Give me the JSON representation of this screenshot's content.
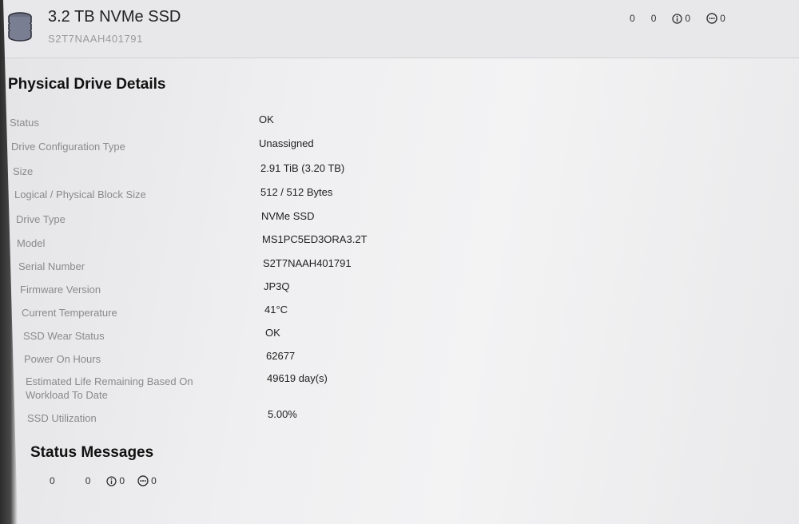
{
  "header": {
    "title": "3.2 TB NVMe SSD",
    "serial": "S2T7NAAH401791",
    "counters": [
      "0",
      "0",
      "0",
      "0"
    ]
  },
  "details": {
    "title": "Physical Drive Details",
    "rows": [
      {
        "label": "Status",
        "value": "OK"
      },
      {
        "label": "Drive Configuration Type",
        "value": "Unassigned"
      },
      {
        "label": "Size",
        "value": "2.91 TiB (3.20 TB)"
      },
      {
        "label": "Logical / Physical Block Size",
        "value": "512 / 512 Bytes"
      },
      {
        "label": "Drive Type",
        "value": "NVMe SSD"
      },
      {
        "label": "Model",
        "value": "MS1PC5ED3ORA3.2T"
      },
      {
        "label": "Serial Number",
        "value": "S2T7NAAH401791"
      },
      {
        "label": "Firmware Version",
        "value": "JP3Q"
      },
      {
        "label": "Current Temperature",
        "value": "41°C"
      },
      {
        "label": "SSD Wear Status",
        "value": "OK"
      },
      {
        "label": "Power On Hours",
        "value": "62677"
      },
      {
        "label": "Estimated Life Remaining Based On Workload To Date",
        "value": "49619 day(s)"
      },
      {
        "label": "SSD Utilization",
        "value": "5.00%"
      }
    ]
  },
  "status_messages": {
    "title": "Status Messages",
    "counters": [
      "0",
      "0",
      "0",
      "0"
    ]
  }
}
